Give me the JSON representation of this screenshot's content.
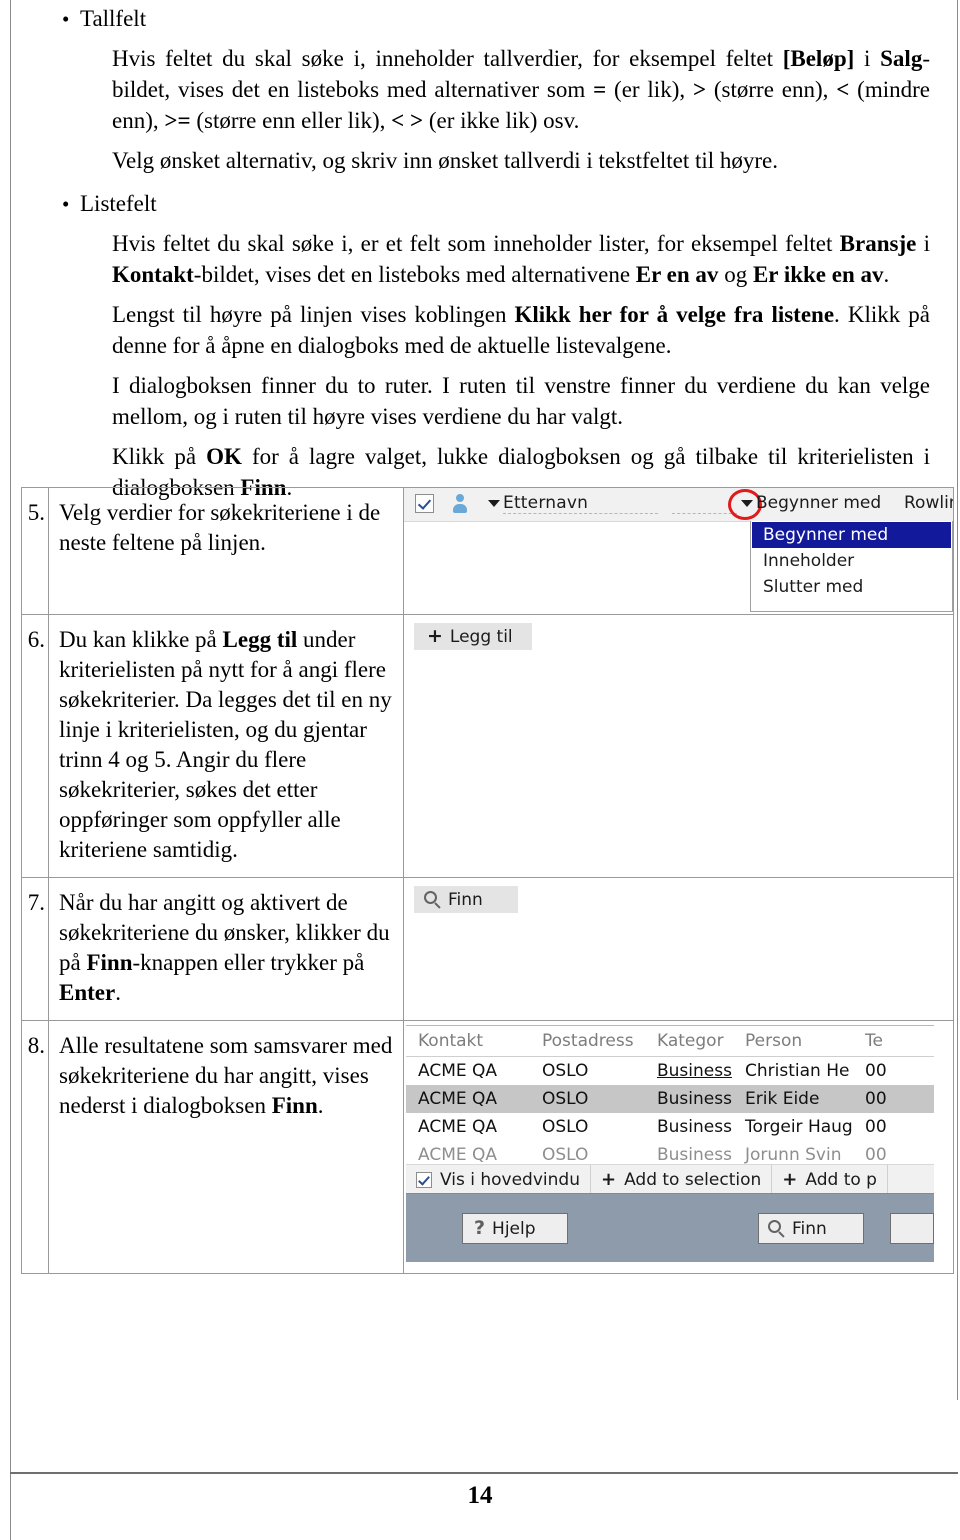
{
  "document": {
    "page_number": "14"
  },
  "bullets": [
    {
      "heading": "Tallfelt",
      "paragraphs": [
        {
          "runs": [
            {
              "t": "Hvis feltet du skal søke i, inneholder tallverdier, for eksempel feltet ",
              "b": false
            },
            {
              "t": "[Beløp]",
              "b": true
            },
            {
              "t": " i ",
              "b": false
            },
            {
              "t": "Salg",
              "b": true
            },
            {
              "t": "-bildet, vises det en listeboks med alternativer som ",
              "b": false
            },
            {
              "t": "=",
              "b": true
            },
            {
              "t": " (er lik), ",
              "b": false
            },
            {
              "t": ">",
              "b": true
            },
            {
              "t": " (større enn), ",
              "b": false
            },
            {
              "t": "<",
              "b": true
            },
            {
              "t": " (mindre enn), ",
              "b": false
            },
            {
              "t": ">=",
              "b": true
            },
            {
              "t": " (større enn eller lik), ",
              "b": false
            },
            {
              "t": "< >",
              "b": true
            },
            {
              "t": " (er ikke lik) osv.",
              "b": false
            }
          ]
        },
        {
          "runs": [
            {
              "t": "Velg ønsket alternativ, og skriv inn ønsket tallverdi i tekstfeltet til høyre.",
              "b": false
            }
          ]
        }
      ]
    },
    {
      "heading": "Listefelt",
      "paragraphs": [
        {
          "runs": [
            {
              "t": "Hvis feltet du skal søke i, er et felt som inneholder lister, for eksempel feltet ",
              "b": false
            },
            {
              "t": "Bransje",
              "b": true
            },
            {
              "t": " i ",
              "b": false
            },
            {
              "t": "Kontakt",
              "b": true
            },
            {
              "t": "-bildet, vises det en listeboks med alternativene ",
              "b": false
            },
            {
              "t": "Er en av",
              "b": true
            },
            {
              "t": " og ",
              "b": false
            },
            {
              "t": "Er ikke en av",
              "b": true
            },
            {
              "t": ".",
              "b": false
            }
          ]
        },
        {
          "runs": [
            {
              "t": "Lengst til høyre på linjen vises koblingen ",
              "b": false
            },
            {
              "t": "Klikk her for å velge fra listene",
              "b": true
            },
            {
              "t": ". Klikk på denne for å åpne en dialogboks med de aktuelle listevalgene.",
              "b": false
            }
          ]
        },
        {
          "runs": [
            {
              "t": "I dialogboksen finner du to ruter. I ruten til venstre finner du verdiene du kan velge mellom, og i ruten til høyre vises verdiene du har valgt.",
              "b": false
            }
          ]
        },
        {
          "runs": [
            {
              "t": "Klikk på ",
              "b": false
            },
            {
              "t": "OK",
              "b": true
            },
            {
              "t": " for å lagre valget, lukke dialogboksen og gå tilbake til kriterielisten i dialogboksen ",
              "b": false
            },
            {
              "t": "Finn",
              "b": true
            },
            {
              "t": ".",
              "b": false
            }
          ]
        }
      ]
    }
  ],
  "steps": [
    {
      "number": "5.",
      "runs": [
        {
          "t": "Velg verdier for søkekriteriene i de neste feltene på linjen.",
          "b": false
        }
      ]
    },
    {
      "number": "6.",
      "runs": [
        {
          "t": "Du kan klikke på ",
          "b": false
        },
        {
          "t": "Legg til",
          "b": true
        },
        {
          "t": " under kriterielisten på nytt for å angi flere søkekriterier. Da legges det til en ny linje i kriterielisten, og du gjentar trinn 4 og 5. Angir du flere søkekriterier, søkes det etter oppføringer som oppfyller alle kriteriene samtidig.",
          "b": false
        }
      ]
    },
    {
      "number": "7.",
      "runs": [
        {
          "t": "Når du har angitt og aktivert de søkekriteriene du ønsker, klikker du på ",
          "b": false
        },
        {
          "t": "Finn",
          "b": true
        },
        {
          "t": "-knappen eller trykker på ",
          "b": false
        },
        {
          "t": "Enter",
          "b": true
        },
        {
          "t": ".",
          "b": false
        }
      ]
    },
    {
      "number": "8.",
      "runs": [
        {
          "t": "Alle resultatene som samsvarer med søkekriteriene du har angitt, vises nederst i dialogboksen ",
          "b": false
        },
        {
          "t": "Finn",
          "b": true
        },
        {
          "t": ".",
          "b": false
        }
      ]
    }
  ],
  "screenshots": {
    "criteria_row": {
      "field_name": "Etternavn",
      "operator": "Begynner med",
      "value": "Rowlin",
      "dropdown_options": [
        "Begynner med",
        "Inneholder",
        "Slutter med"
      ],
      "selected_option": "Begynner med",
      "highlight_color": "#e01b1b",
      "selection_color": "#12199b"
    },
    "add_button": {
      "label": "Legg til",
      "icon": "plus-icon"
    },
    "find_button": {
      "label": "Finn",
      "icon": "magnifier-icon"
    },
    "results": {
      "columns": [
        "Kontakt",
        "Postadress",
        "Kategor",
        "Person",
        "Te"
      ],
      "rows": [
        {
          "cells": [
            "ACME QA",
            "OSLO",
            "Business",
            "Christian He",
            "00"
          ],
          "selected": false,
          "faded": false
        },
        {
          "cells": [
            "ACME QA",
            "OSLO",
            "Business",
            "Erik Eide",
            "00"
          ],
          "selected": true,
          "faded": false
        },
        {
          "cells": [
            "ACME QA",
            "OSLO",
            "Business",
            "Torgeir Haug",
            "00"
          ],
          "selected": false,
          "faded": false
        },
        {
          "cells": [
            "ACME QA",
            "OSLO",
            "Business",
            "Jorunn Svin",
            "00"
          ],
          "selected": false,
          "faded": true
        }
      ],
      "selection_bar": {
        "show_in_main_window": "Vis i hovedvindu",
        "add_to_selection": "Add to selection",
        "add_to_project": "Add to p"
      },
      "footer": {
        "help_label": "Hjelp",
        "find_label": "Finn",
        "help_icon": "question-mark-icon",
        "find_icon": "magnifier-icon",
        "background_color": "#8e9bab"
      }
    }
  }
}
